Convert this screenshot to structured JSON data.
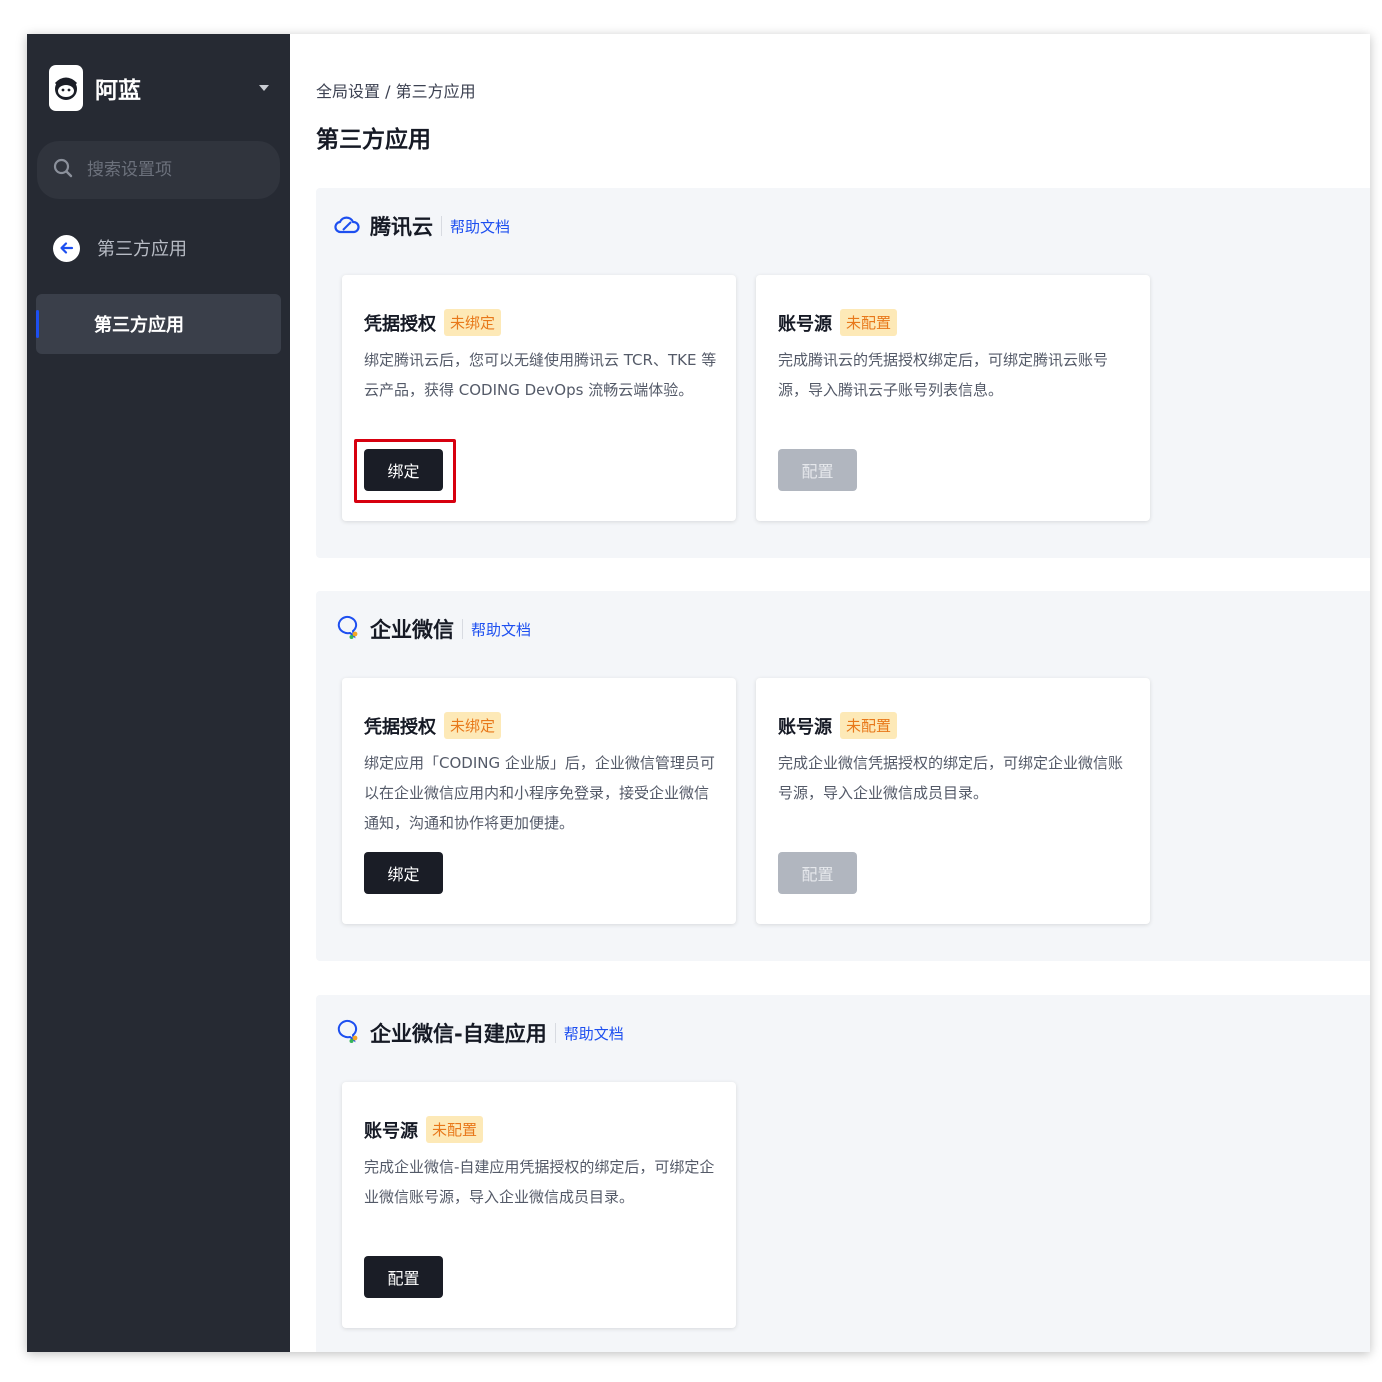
{
  "brand": {
    "name": "阿蓝",
    "logo_icon": "avatar-logo-icon"
  },
  "search": {
    "placeholder": "搜索设置项"
  },
  "sidebar": {
    "back_label": "第三方应用",
    "active_item": "第三方应用"
  },
  "breadcrumb": "全局设置 / 第三方应用",
  "page_title": "第三方应用",
  "colors": {
    "link": "#1d4ff0",
    "badge_bg": "#fde9b7",
    "badge_text": "#e8781a",
    "button_dark": "#1a1d26",
    "highlight": "#d7000f"
  },
  "sections": [
    {
      "name": "腾讯云",
      "icon": "tencent-cloud-icon",
      "help": "帮助文档",
      "cards": [
        {
          "title": "凭据授权",
          "badge": "未绑定",
          "desc": "绑定腾讯云后，您可以无缝使用腾讯云 TCR、TKE 等云产品，获得 CODING DevOps 流畅云端体验。",
          "button": "绑定",
          "disabled": false
        },
        {
          "title": "账号源",
          "badge": "未配置",
          "desc": "完成腾讯云的凭据授权绑定后，可绑定腾讯云账号源，导入腾讯云子账号列表信息。",
          "button": "配置",
          "disabled": true
        }
      ]
    },
    {
      "name": "企业微信",
      "icon": "wecom-icon",
      "help": "帮助文档",
      "cards": [
        {
          "title": "凭据授权",
          "badge": "未绑定",
          "desc": "绑定应用「CODING 企业版」后，企业微信管理员可以在企业微信应用内和小程序免登录，接受企业微信通知，沟通和协作将更加便捷。",
          "button": "绑定",
          "disabled": false
        },
        {
          "title": "账号源",
          "badge": "未配置",
          "desc": "完成企业微信凭据授权的绑定后，可绑定企业微信账号源，导入企业微信成员目录。",
          "button": "配置",
          "disabled": true
        }
      ]
    },
    {
      "name": "企业微信-自建应用",
      "icon": "wecom-icon",
      "help": "帮助文档",
      "cards": [
        {
          "title": "账号源",
          "badge": "未配置",
          "desc": "完成企业微信-自建应用凭据授权的绑定后，可绑定企业微信账号源，导入企业微信成员目录。",
          "button": "配置",
          "disabled": false
        }
      ]
    }
  ]
}
